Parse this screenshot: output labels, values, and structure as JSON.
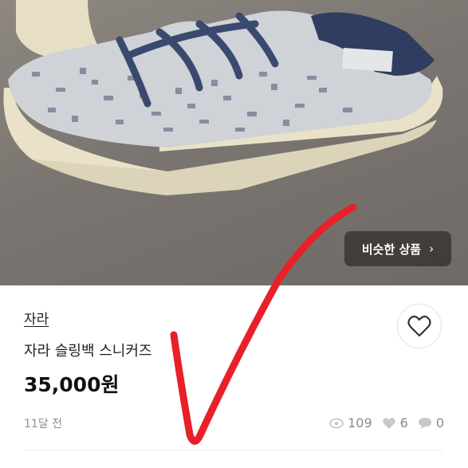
{
  "photo": {
    "similar_button_label": "비슷한 상품",
    "similar_button_icon": "chevron-right-icon"
  },
  "product": {
    "brand": "자라",
    "title": "자라 슬링백 스니커즈",
    "price": "35,000원",
    "posted": "11달 전"
  },
  "stats": {
    "views": "109",
    "likes": "6",
    "chats": "0"
  },
  "icons": {
    "like": "heart-outline-icon",
    "views": "eye-icon",
    "likes": "heart-icon",
    "chats": "chat-bubble-icon"
  },
  "colors": {
    "accent_overlay": "#e8202a",
    "price": "#111111",
    "muted": "#8e8e8e"
  }
}
